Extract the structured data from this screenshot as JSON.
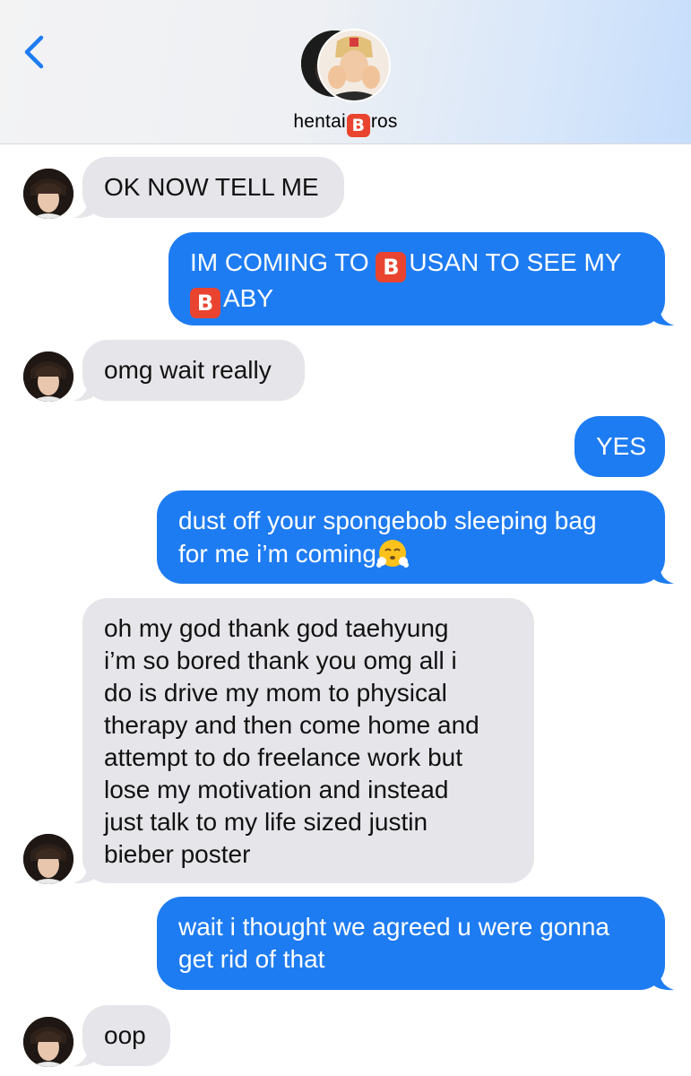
{
  "header": {
    "back_icon": "chevron-left-icon",
    "title_prefix": "hentai ",
    "title_emoji": "B",
    "title_suffix": "ros",
    "accent_color": "#1e7cf2"
  },
  "messages": [
    {
      "sender": "them",
      "text": "OK NOW TELL ME"
    },
    {
      "sender": "me",
      "line1_a": "IM COMING TO ",
      "line1_emoji": "B",
      "line1_b": "USAN TO SEE MY",
      "line2_emoji": "B",
      "line2_b": "ABY"
    },
    {
      "sender": "them",
      "text": "omg wait really"
    },
    {
      "sender": "me",
      "text": "YES"
    },
    {
      "sender": "me",
      "text_a": "dust off your spongebob sleeping bag\nfor me i’m coming",
      "emoji": "face-with-steam-icon"
    },
    {
      "sender": "them",
      "text": "oh my god thank god taehyung\ni’m so bored thank you omg all i\ndo is drive my mom to physical\ntherapy and then come home and\nattempt to do freelance work but\nlose my motivation and instead\njust talk to my life sized justin\nbieber poster"
    },
    {
      "sender": "me",
      "text": "wait i thought we agreed u were gonna\nget rid of that"
    },
    {
      "sender": "them",
      "text": "oop"
    }
  ],
  "colors": {
    "incoming_bubble": "#e5e5ea",
    "outgoing_bubble": "#1e7cf2",
    "b_emoji": "#e9442f"
  }
}
